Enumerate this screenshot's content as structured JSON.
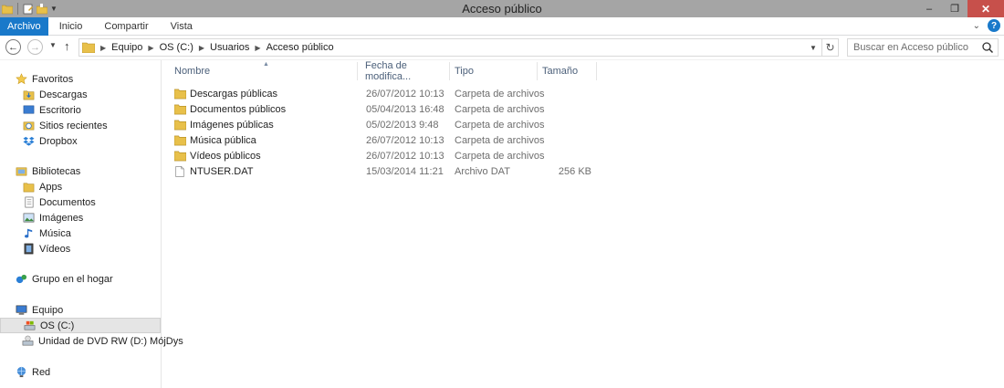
{
  "window": {
    "title": "Acceso público",
    "minimize": "–",
    "restore": "❐",
    "close": "✕"
  },
  "ribbon": {
    "tabs": [
      "Archivo",
      "Inicio",
      "Compartir",
      "Vista"
    ],
    "help": "?"
  },
  "address": {
    "crumbs": [
      "Equipo",
      "OS (C:)",
      "Usuarios",
      "Acceso público"
    ]
  },
  "search": {
    "placeholder": "Buscar en Acceso público"
  },
  "navpane": {
    "favoritos": {
      "label": "Favoritos",
      "items": [
        "Descargas",
        "Escritorio",
        "Sitios recientes",
        "Dropbox"
      ]
    },
    "bibliotecas": {
      "label": "Bibliotecas",
      "items": [
        "Apps",
        "Documentos",
        "Imágenes",
        "Música",
        "Vídeos"
      ]
    },
    "grupo_hogar": {
      "label": "Grupo en el hogar"
    },
    "equipo": {
      "label": "Equipo",
      "items": [
        "OS (C:)",
        "Unidad de DVD RW (D:) MójDys"
      ]
    },
    "red": {
      "label": "Red"
    }
  },
  "columns": {
    "name": "Nombre",
    "date": "Fecha de modifica...",
    "type": "Tipo",
    "size": "Tamaño"
  },
  "files": [
    {
      "name": "Descargas públicas",
      "date": "26/07/2012 10:13",
      "type": "Carpeta de archivos",
      "size": "",
      "kind": "folder"
    },
    {
      "name": "Documentos públicos",
      "date": "05/04/2013 16:48",
      "type": "Carpeta de archivos",
      "size": "",
      "kind": "folder"
    },
    {
      "name": "Imágenes públicas",
      "date": "05/02/2013 9:48",
      "type": "Carpeta de archivos",
      "size": "",
      "kind": "folder"
    },
    {
      "name": "Música pública",
      "date": "26/07/2012 10:13",
      "type": "Carpeta de archivos",
      "size": "",
      "kind": "folder"
    },
    {
      "name": "Vídeos públicos",
      "date": "26/07/2012 10:13",
      "type": "Carpeta de archivos",
      "size": "",
      "kind": "folder"
    },
    {
      "name": "NTUSER.DAT",
      "date": "15/03/2014 11:21",
      "type": "Archivo DAT",
      "size": "256 KB",
      "kind": "file"
    }
  ],
  "colors": {
    "accent": "#1979ca",
    "titlebar": "#a5a5a5",
    "close": "#c7504b",
    "folder": "#e8c04a"
  }
}
